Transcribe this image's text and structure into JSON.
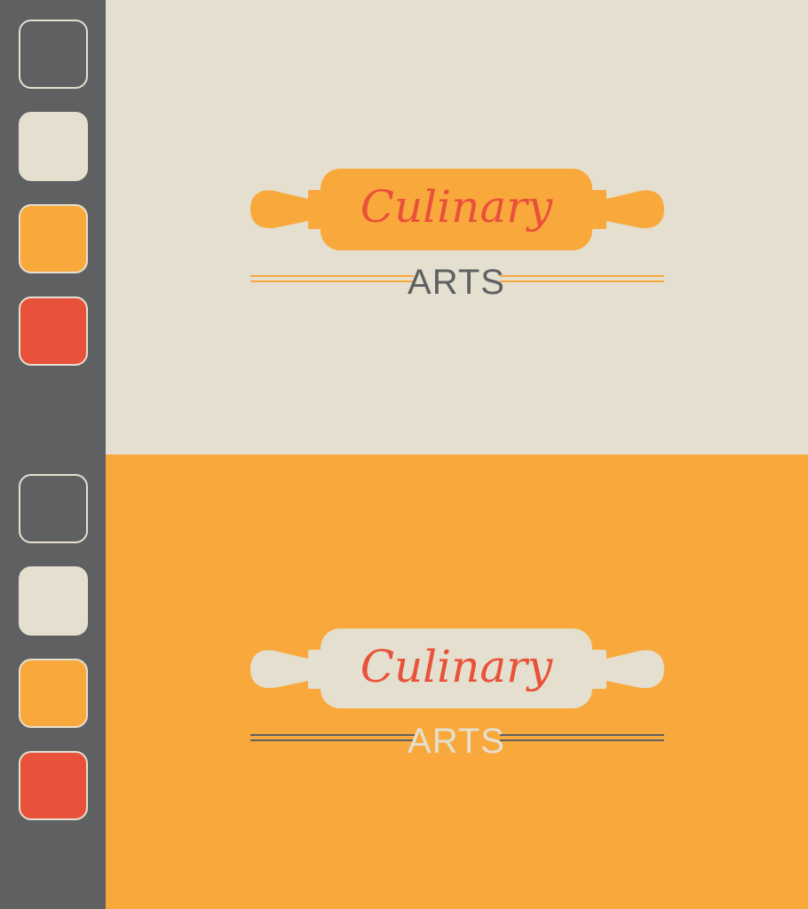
{
  "colors": {
    "charcoal": "#5f6062",
    "cream": "#e4dfcf",
    "orange": "#f9a93c",
    "red": "#e9523a"
  },
  "palette_swatches": [
    "#5f6062",
    "#e4dfcf",
    "#f9a93c",
    "#e9523a"
  ],
  "logo_light": {
    "background": "#e4dfcf",
    "rolling_pin_color": "#f9a93c",
    "script_color": "#e9523a",
    "arts_color": "#5f6062",
    "line_color": "#f9a93c",
    "script_text": "Culinary",
    "arts_text": "ARTS",
    "icon": "rolling-pin-icon"
  },
  "logo_orange": {
    "background": "#f9a93c",
    "rolling_pin_color": "#e4dfcf",
    "script_color": "#e9523a",
    "arts_color": "#e4dfcf",
    "line_color": "#5f6062",
    "script_text": "Culinary",
    "arts_text": "ARTS",
    "icon": "rolling-pin-icon"
  }
}
